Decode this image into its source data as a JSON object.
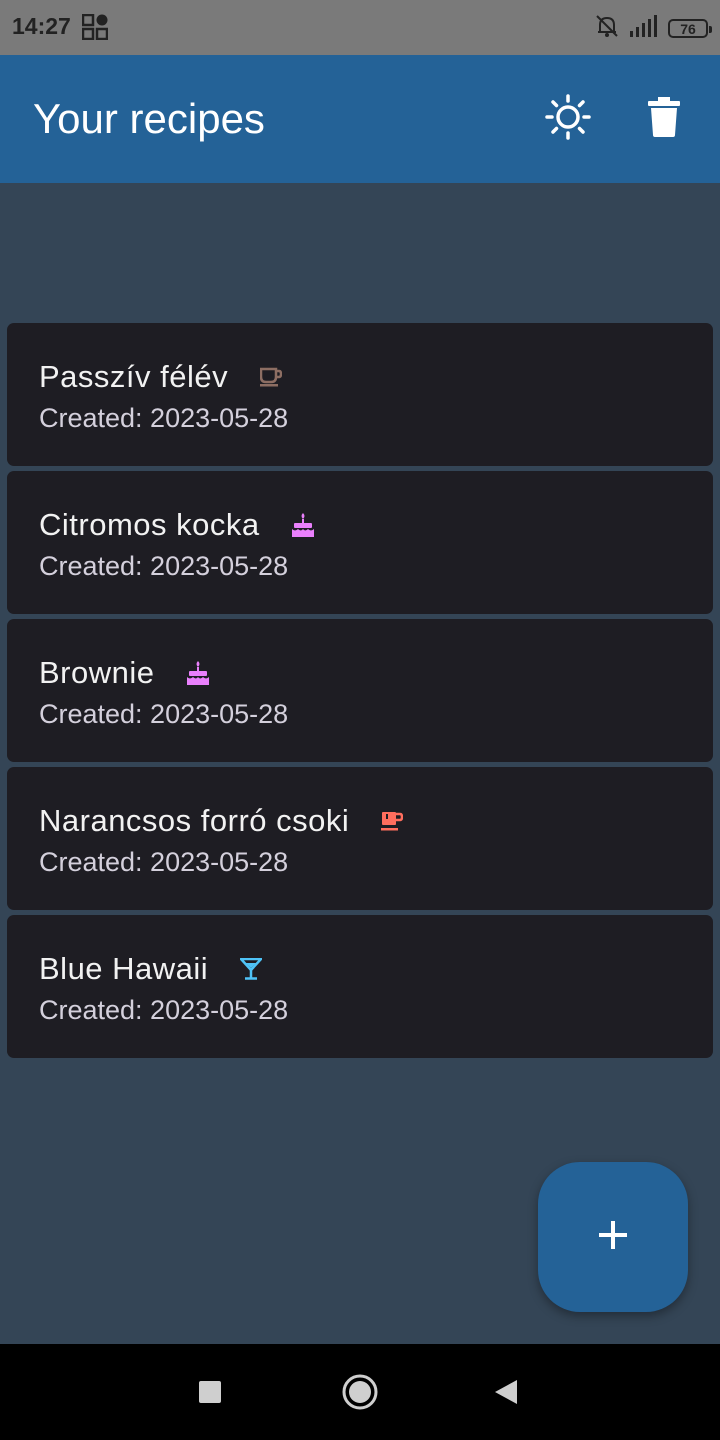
{
  "status_bar": {
    "time": "14:27",
    "battery": "76",
    "icons": [
      "qr-code-icon",
      "alarm-off-icon",
      "signal-icon",
      "battery-icon"
    ]
  },
  "app_bar": {
    "title": "Your recipes",
    "actions": [
      "theme-toggle-icon",
      "delete-icon"
    ]
  },
  "recipes": [
    {
      "name": "Passzív félév",
      "created": "Created: 2023-05-28",
      "icon": "coffee-icon",
      "icon_color": "#8d6e63"
    },
    {
      "name": "Citromos kocka",
      "created": "Created: 2023-05-28",
      "icon": "cake-icon",
      "icon_color": "#ea80fc"
    },
    {
      "name": "Brownie",
      "created": "Created: 2023-05-28",
      "icon": "cake-icon",
      "icon_color": "#ea80fc"
    },
    {
      "name": "Narancsos forró csoki",
      "created": "Created: 2023-05-28",
      "icon": "hot-drink-icon",
      "icon_color": "#ff6e5e"
    },
    {
      "name": "Blue Hawaii",
      "created": "Created: 2023-05-28",
      "icon": "cocktail-icon",
      "icon_color": "#4fc3f7"
    }
  ],
  "fab": {
    "icon": "add-icon"
  },
  "colors": {
    "app_bar": "#246297",
    "background": "#344556",
    "card": "#1e1d23",
    "fab": "#246297"
  },
  "nav_bar": {
    "buttons": [
      "recents-icon",
      "home-icon",
      "back-icon"
    ]
  }
}
